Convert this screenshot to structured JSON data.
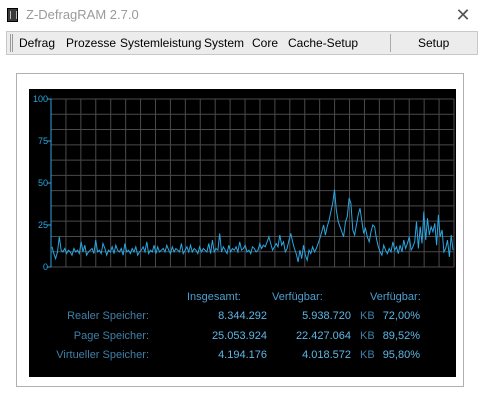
{
  "window": {
    "title": "Z-DefragRAM 2.7.0",
    "close_glyph": "✕"
  },
  "menu": {
    "items": [
      "Defrag",
      "Prozesse",
      "Systemleistung",
      "System",
      "Core",
      "Cache-Setup"
    ],
    "setup": "Setup"
  },
  "graph": {
    "y_ticks": [
      "100",
      "75",
      "50",
      "25",
      "0"
    ],
    "background_color": "#000000",
    "grid_color": "#4a4a4a",
    "line_color": "#2aa6e0",
    "samples": [
      12,
      8,
      5,
      9,
      18,
      10,
      9,
      11,
      8,
      10,
      9,
      7,
      11,
      9,
      10,
      8,
      15,
      9,
      13,
      7,
      9,
      10,
      11,
      8,
      16,
      9,
      10,
      8,
      14,
      11,
      7,
      10,
      9,
      12,
      8,
      13,
      10,
      9,
      11,
      7,
      14,
      9,
      10,
      8,
      11,
      9,
      12,
      7,
      9,
      10,
      12,
      9,
      15,
      8,
      10,
      9,
      13,
      8,
      12,
      9,
      10,
      11,
      9,
      13,
      10,
      8,
      12,
      9,
      11,
      10,
      9,
      14,
      8,
      10,
      12,
      9,
      13,
      9,
      11,
      10,
      8,
      12,
      9,
      11,
      10,
      9,
      14,
      8,
      16,
      9,
      11,
      10,
      20,
      9,
      12,
      10,
      8,
      13,
      9,
      11,
      10,
      12,
      9,
      15,
      10,
      11,
      13,
      9,
      10,
      8,
      12,
      11,
      9,
      10,
      14,
      11,
      13,
      12,
      15,
      18,
      14,
      10,
      12,
      14,
      12,
      19,
      13,
      15,
      9,
      11,
      16,
      20,
      15,
      11,
      8,
      3,
      10,
      5,
      13,
      7,
      4,
      10,
      8,
      12,
      9,
      11,
      14,
      17,
      21,
      25,
      19,
      24,
      28,
      33,
      38,
      46,
      34,
      27,
      24,
      21,
      18,
      27,
      30,
      41,
      38,
      22,
      19,
      25,
      31,
      35,
      27,
      20,
      23,
      18,
      15,
      21,
      25,
      24,
      17,
      12,
      9,
      7,
      13,
      10,
      8,
      11,
      9,
      15,
      10,
      12,
      8,
      13,
      9,
      16,
      11,
      14,
      18,
      10,
      12,
      15,
      27,
      11,
      24,
      14,
      33,
      16,
      29,
      19,
      24,
      21,
      26,
      13,
      31,
      18,
      22,
      9,
      11,
      16,
      6,
      19,
      10
    ]
  },
  "stats": {
    "headers": [
      "Insgesamt:",
      "Verfügbar:",
      "Verfügbar:"
    ],
    "rows": [
      {
        "label": "Realer Speicher:",
        "total": "8.344.292",
        "available": "5.938.720",
        "unit": "KB",
        "percent": "72,00%"
      },
      {
        "label": "Page Speicher:",
        "total": "25.053.924",
        "available": "22.427.064",
        "unit": "KB",
        "percent": "89,52%"
      },
      {
        "label": "Virtueller Speicher:",
        "total": "4.194.176",
        "available": "4.018.572",
        "unit": "KB",
        "percent": "95,80%"
      }
    ]
  }
}
